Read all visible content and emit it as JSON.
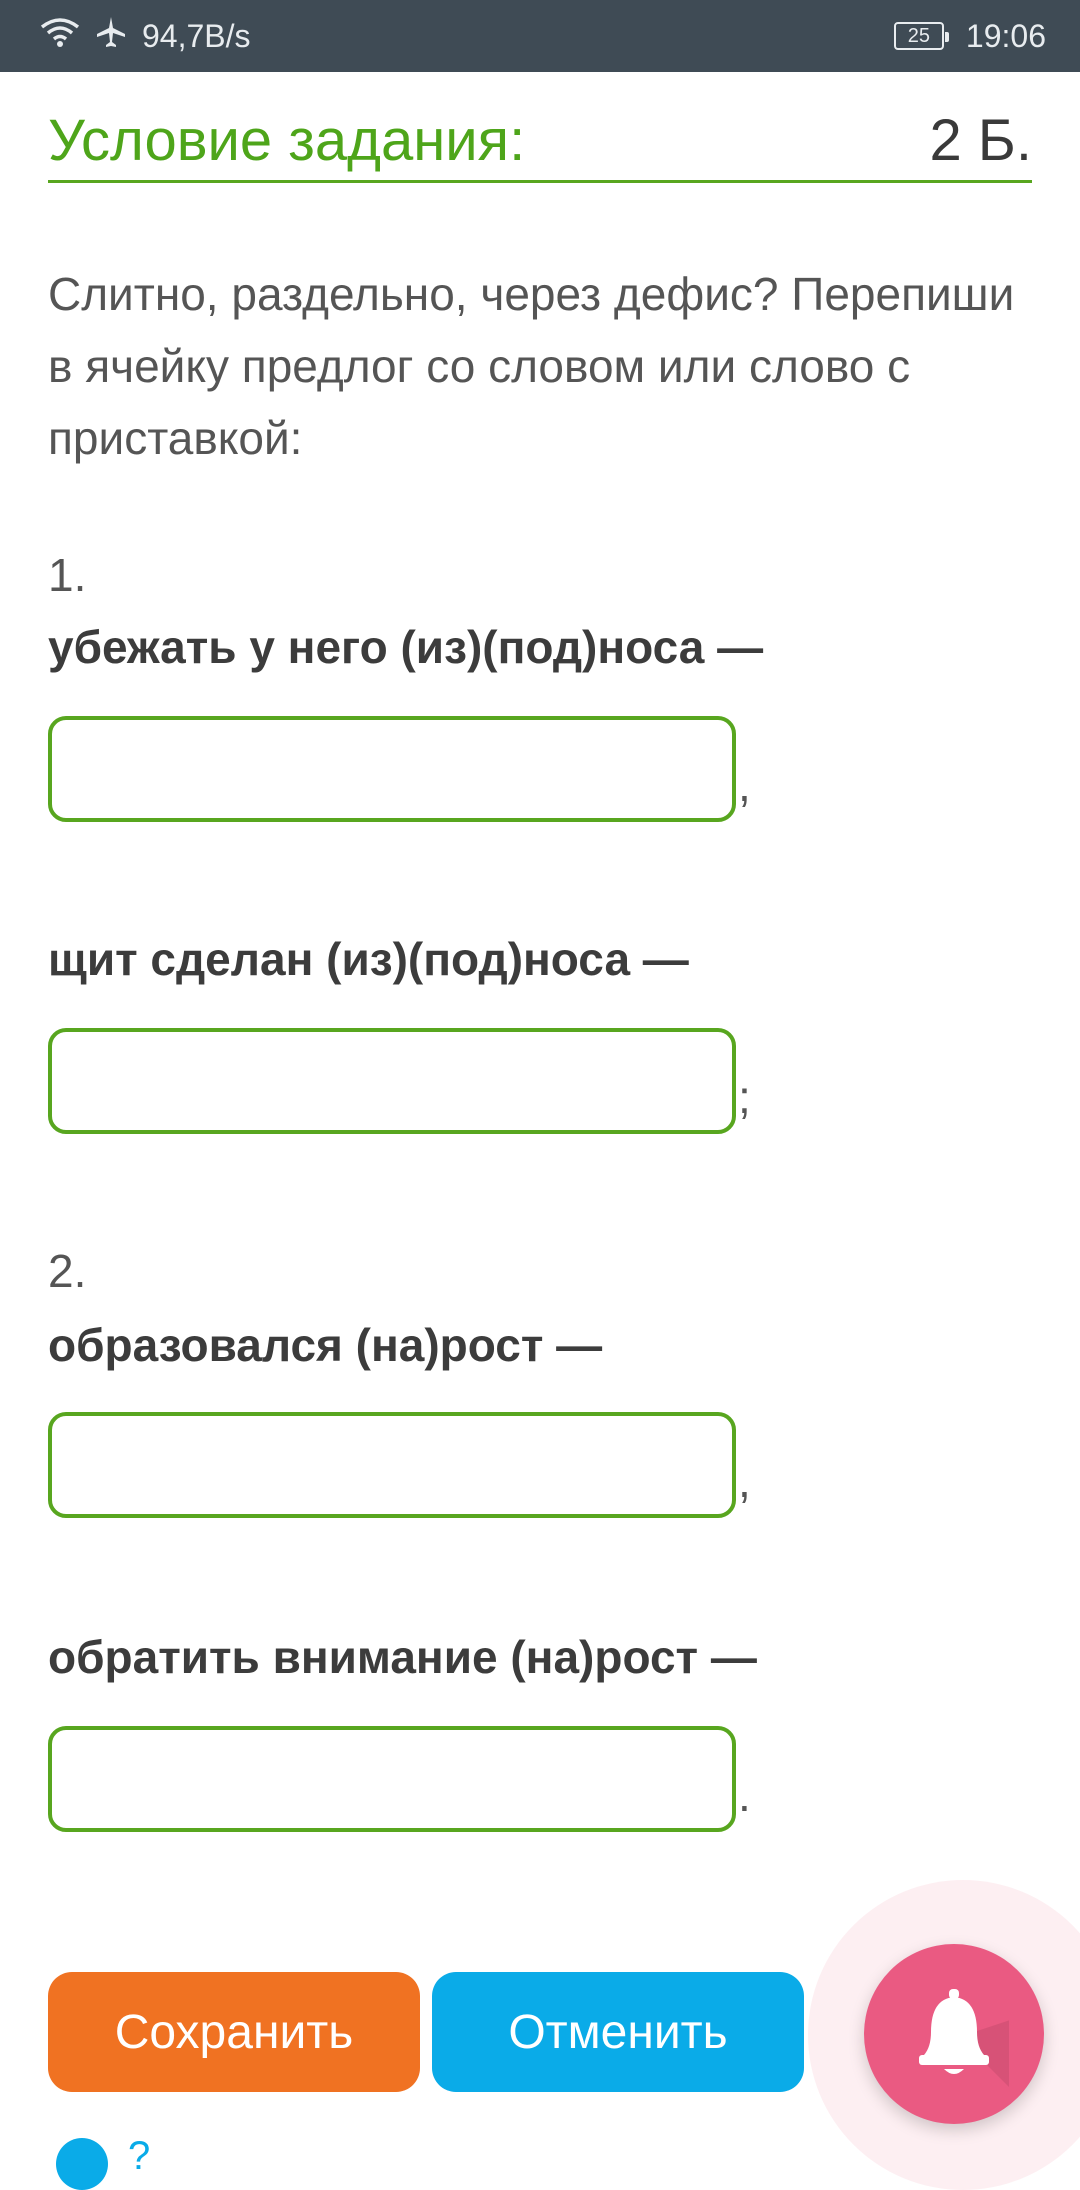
{
  "status_bar": {
    "speed": "94,7B/s",
    "battery": "25",
    "time": "19:06",
    "icons": [
      "wifi-icon",
      "airplane-icon",
      "battery-icon"
    ]
  },
  "header": {
    "title": "Условие задания:",
    "points": "2 Б."
  },
  "intro": "Слитно, раздельно, через дефис? Перепиши в ячейку предлог со словом или слово с приставкой:",
  "questions": [
    {
      "number": "1.",
      "items": [
        {
          "text": "убежать у него (из)(под)носа —",
          "value": "",
          "punct": ","
        },
        {
          "text": "щит сделан (из)(под)носа —",
          "value": "",
          "punct": ";"
        }
      ]
    },
    {
      "number": "2.",
      "items": [
        {
          "text": "образовался (на)рост —",
          "value": "",
          "punct": ","
        },
        {
          "text": "обратить внимание (на)рост —",
          "value": "",
          "punct": "."
        }
      ]
    }
  ],
  "buttons": {
    "save": "Сохранить",
    "cancel": "Отменить"
  },
  "colors": {
    "accent_green": "#58a61f",
    "save_orange": "#f07222",
    "cancel_blue": "#0aabe8",
    "bell_pink": "#ea5a82",
    "status_bar": "#3f4b55"
  },
  "footer": {
    "info_text": "?"
  }
}
